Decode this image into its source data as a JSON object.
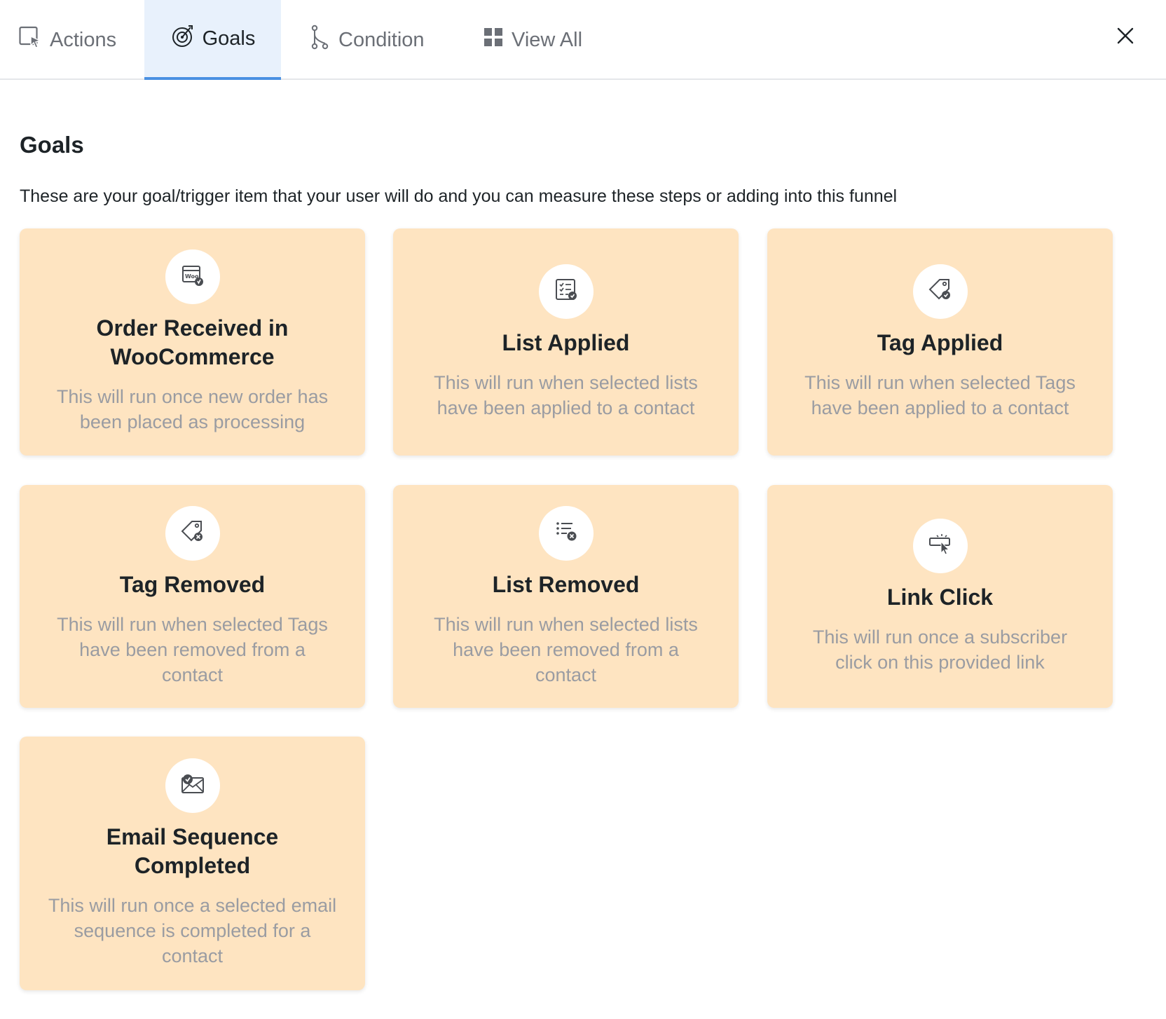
{
  "tabs": [
    {
      "label": "Actions",
      "icon": "actions-icon"
    },
    {
      "label": "Goals",
      "icon": "goals-target-icon",
      "active": true
    },
    {
      "label": "Condition",
      "icon": "condition-branch-icon"
    },
    {
      "label": "View All",
      "icon": "grid-icon"
    }
  ],
  "close_icon": "close-icon",
  "section": {
    "title": "Goals",
    "description": "These are your goal/trigger item that your user will do and you can measure these steps or adding into this funnel"
  },
  "cards": [
    {
      "title": "Order Received in WooCommerce",
      "description": "This will run once new order has been placed as processing",
      "icon": "woocommerce-order-icon"
    },
    {
      "title": "List Applied",
      "description": "This will run when selected lists have been applied to a contact",
      "icon": "list-check-icon"
    },
    {
      "title": "Tag Applied",
      "description": "This will run when selected Tags have been applied to a contact",
      "icon": "tag-check-icon"
    },
    {
      "title": "Tag Removed",
      "description": "This will run when selected Tags have been removed from a contact",
      "icon": "tag-remove-icon"
    },
    {
      "title": "List Removed",
      "description": "This will run when selected lists have been removed from a contact",
      "icon": "list-remove-icon"
    },
    {
      "title": "Link Click",
      "description": "This will run once a subscriber click on this provided link",
      "icon": "link-click-icon"
    },
    {
      "title": "Email Sequence Completed",
      "description": "This will run once a selected email sequence is completed for a contact",
      "icon": "email-check-icon"
    }
  ],
  "colors": {
    "card_background": "#fee4c1",
    "active_tab_background": "#e8f1fc",
    "active_tab_indicator": "#4a90e2",
    "muted_text": "#9a9ca2"
  }
}
